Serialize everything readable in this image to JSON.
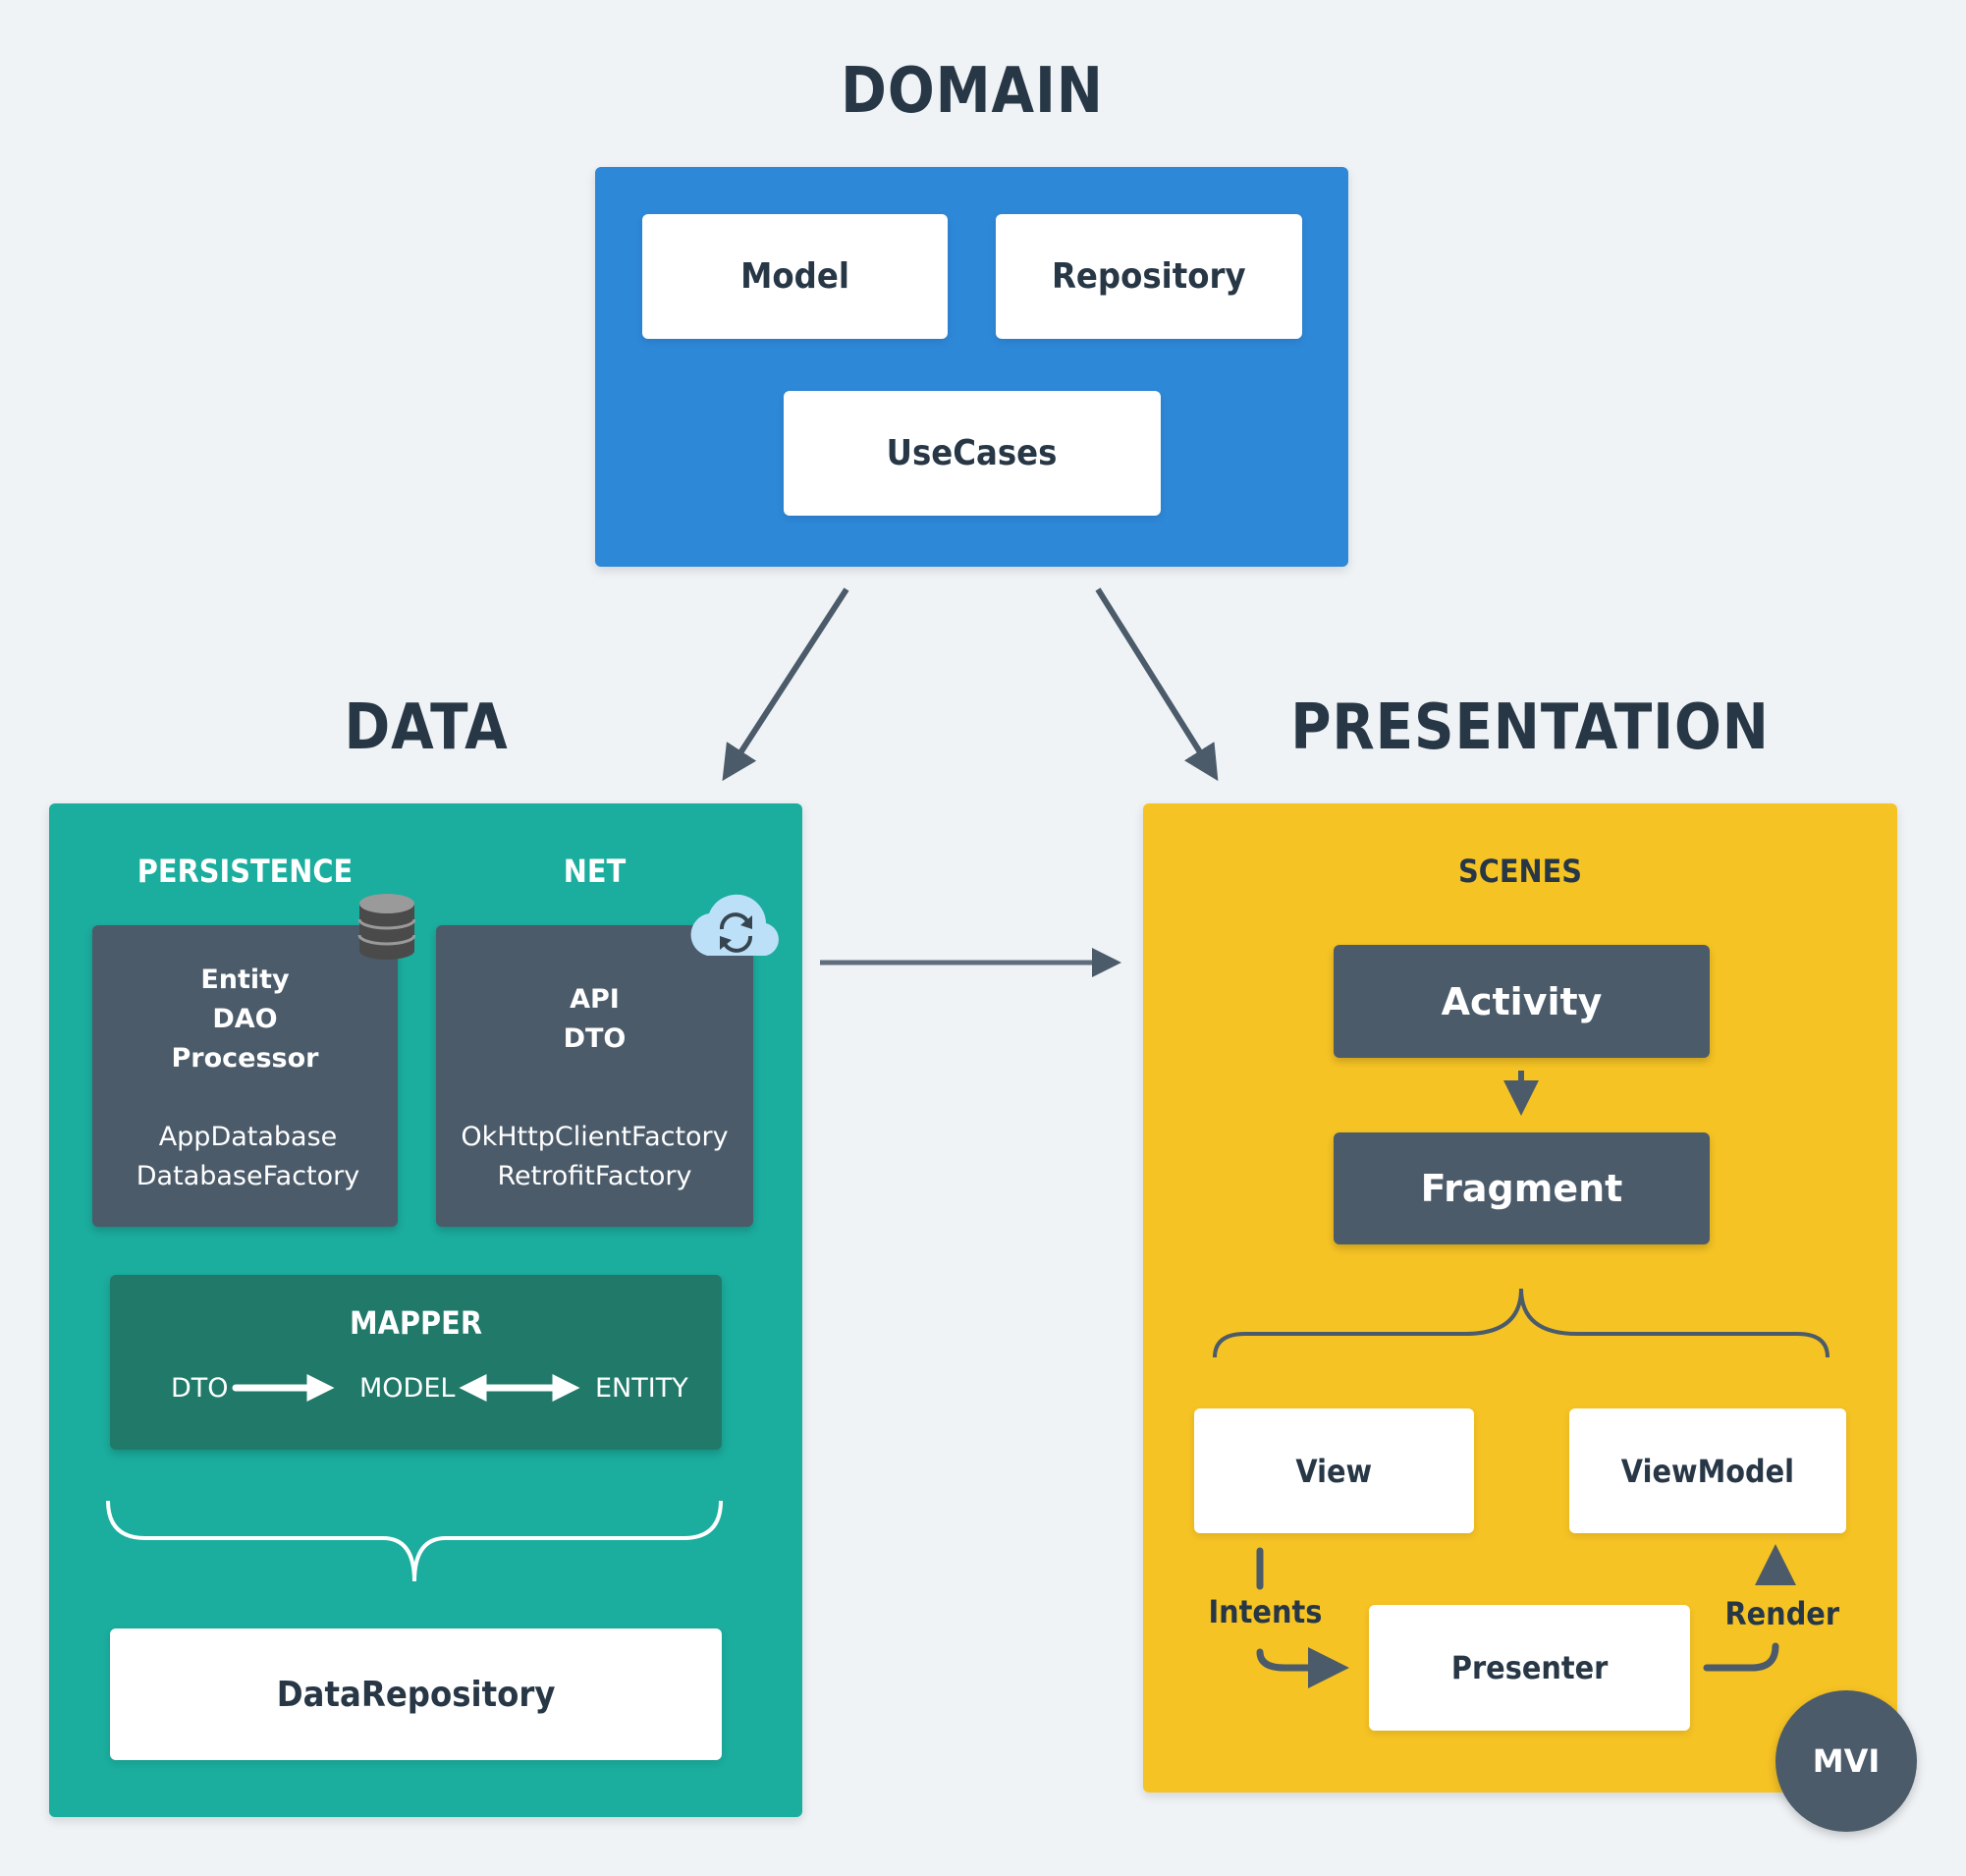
{
  "domain": {
    "title": "DOMAIN",
    "color": "#2e88d8",
    "cards": [
      "Model",
      "Repository",
      "UseCases"
    ]
  },
  "data": {
    "title": "DATA",
    "color": "#1badA0",
    "persistence": {
      "label": "PERSISTENCE",
      "icon": "database-icon",
      "primary": [
        "Entity",
        "DAO",
        "Processor"
      ],
      "secondary": [
        "AppDatabase",
        "DatabaseFactory"
      ]
    },
    "net": {
      "label": "NET",
      "icon": "cloud-sync-icon",
      "primary": [
        "API",
        "DTO"
      ],
      "secondary": [
        "OkHttpClientFactory",
        "RetrofitFactory"
      ]
    },
    "mapper": {
      "label": "MAPPER",
      "color": "#217a69",
      "flow": [
        "DTO",
        "MODEL",
        "ENTITY"
      ]
    },
    "repository": "DataRepository"
  },
  "presentation": {
    "title": "PRESENTATION",
    "color": "#f6c324",
    "scenes_label": "SCENES",
    "activity": "Activity",
    "fragment": "Fragment",
    "view": "View",
    "viewmodel": "ViewModel",
    "presenter": "Presenter",
    "intents_label": "Intents",
    "render_label": "Render",
    "badge": "MVI"
  }
}
